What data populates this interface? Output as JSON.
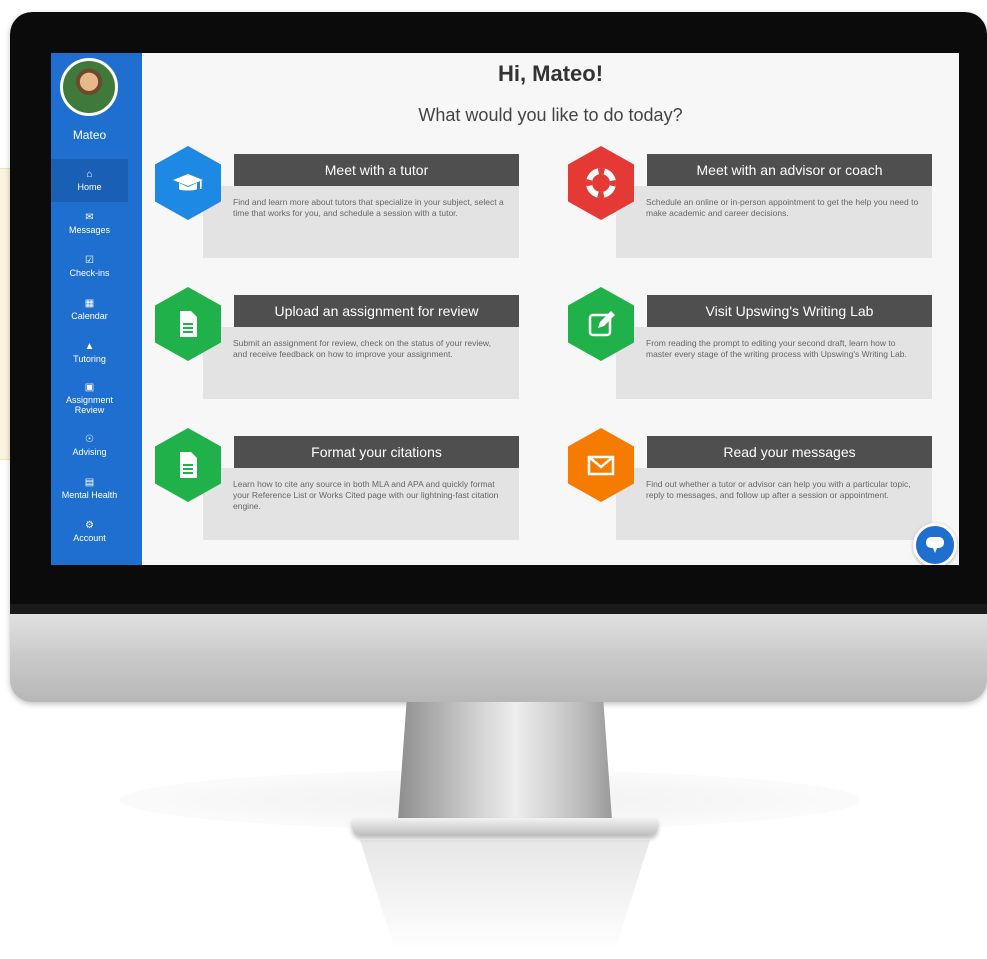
{
  "user": {
    "name": "Mateo"
  },
  "sidebar": {
    "items": [
      {
        "label": "Home",
        "icon": "home-icon"
      },
      {
        "label": "Messages",
        "icon": "envelope-icon"
      },
      {
        "label": "Check-ins",
        "icon": "checkbox-icon"
      },
      {
        "label": "Calendar",
        "icon": "calendar-icon"
      },
      {
        "label": "Tutoring",
        "icon": "graduation-cap-icon"
      },
      {
        "label": "Assignment Review",
        "icon": "document-icon"
      },
      {
        "label": "Advising",
        "icon": "lifebuoy-icon"
      },
      {
        "label": "Mental Health",
        "icon": "first-aid-icon"
      },
      {
        "label": "Account",
        "icon": "gear-icon"
      }
    ]
  },
  "main": {
    "greeting": "Hi, Mateo!",
    "subtitle": "What would you like to do today?",
    "cards": [
      {
        "title": "Meet with a tutor",
        "description": "Find and learn more about tutors that specialize in your subject, select a time that works for you, and schedule a session with a tutor.",
        "icon": "graduation-cap-icon",
        "color": "#1e88e5"
      },
      {
        "title": "Meet with an advisor or coach",
        "description": "Schedule an online or in-person appointment to get the help you need to make academic and career decisions.",
        "icon": "lifebuoy-icon",
        "color": "#e53935"
      },
      {
        "title": "Upload an assignment for review",
        "description": "Submit an assignment for review, check on the status of your review, and receive feedback on how to improve your assignment.",
        "icon": "document-icon",
        "color": "#21b14b"
      },
      {
        "title": "Visit Upswing's Writing Lab",
        "description": "From reading the prompt to editing your second draft, learn how to master every stage of the writing process with Upswing's Writing Lab.",
        "icon": "edit-icon",
        "color": "#21b14b"
      },
      {
        "title": "Format your citations",
        "description": "Learn how to cite any source in both MLA and APA and quickly format your Reference List or Works Cited page with our lightning-fast citation engine.",
        "icon": "document-icon",
        "color": "#21b14b"
      },
      {
        "title": "Read your messages",
        "description": "Find out whether a tutor or advisor can help you with a particular topic, reply to messages, and follow up after a session or appointment.",
        "icon": "envelope-icon",
        "color": "#f57c00"
      }
    ]
  },
  "colors": {
    "sidebar": "#1f6fd1",
    "card_header": "#4f4f4f",
    "card_body": "#e3e3e3"
  }
}
